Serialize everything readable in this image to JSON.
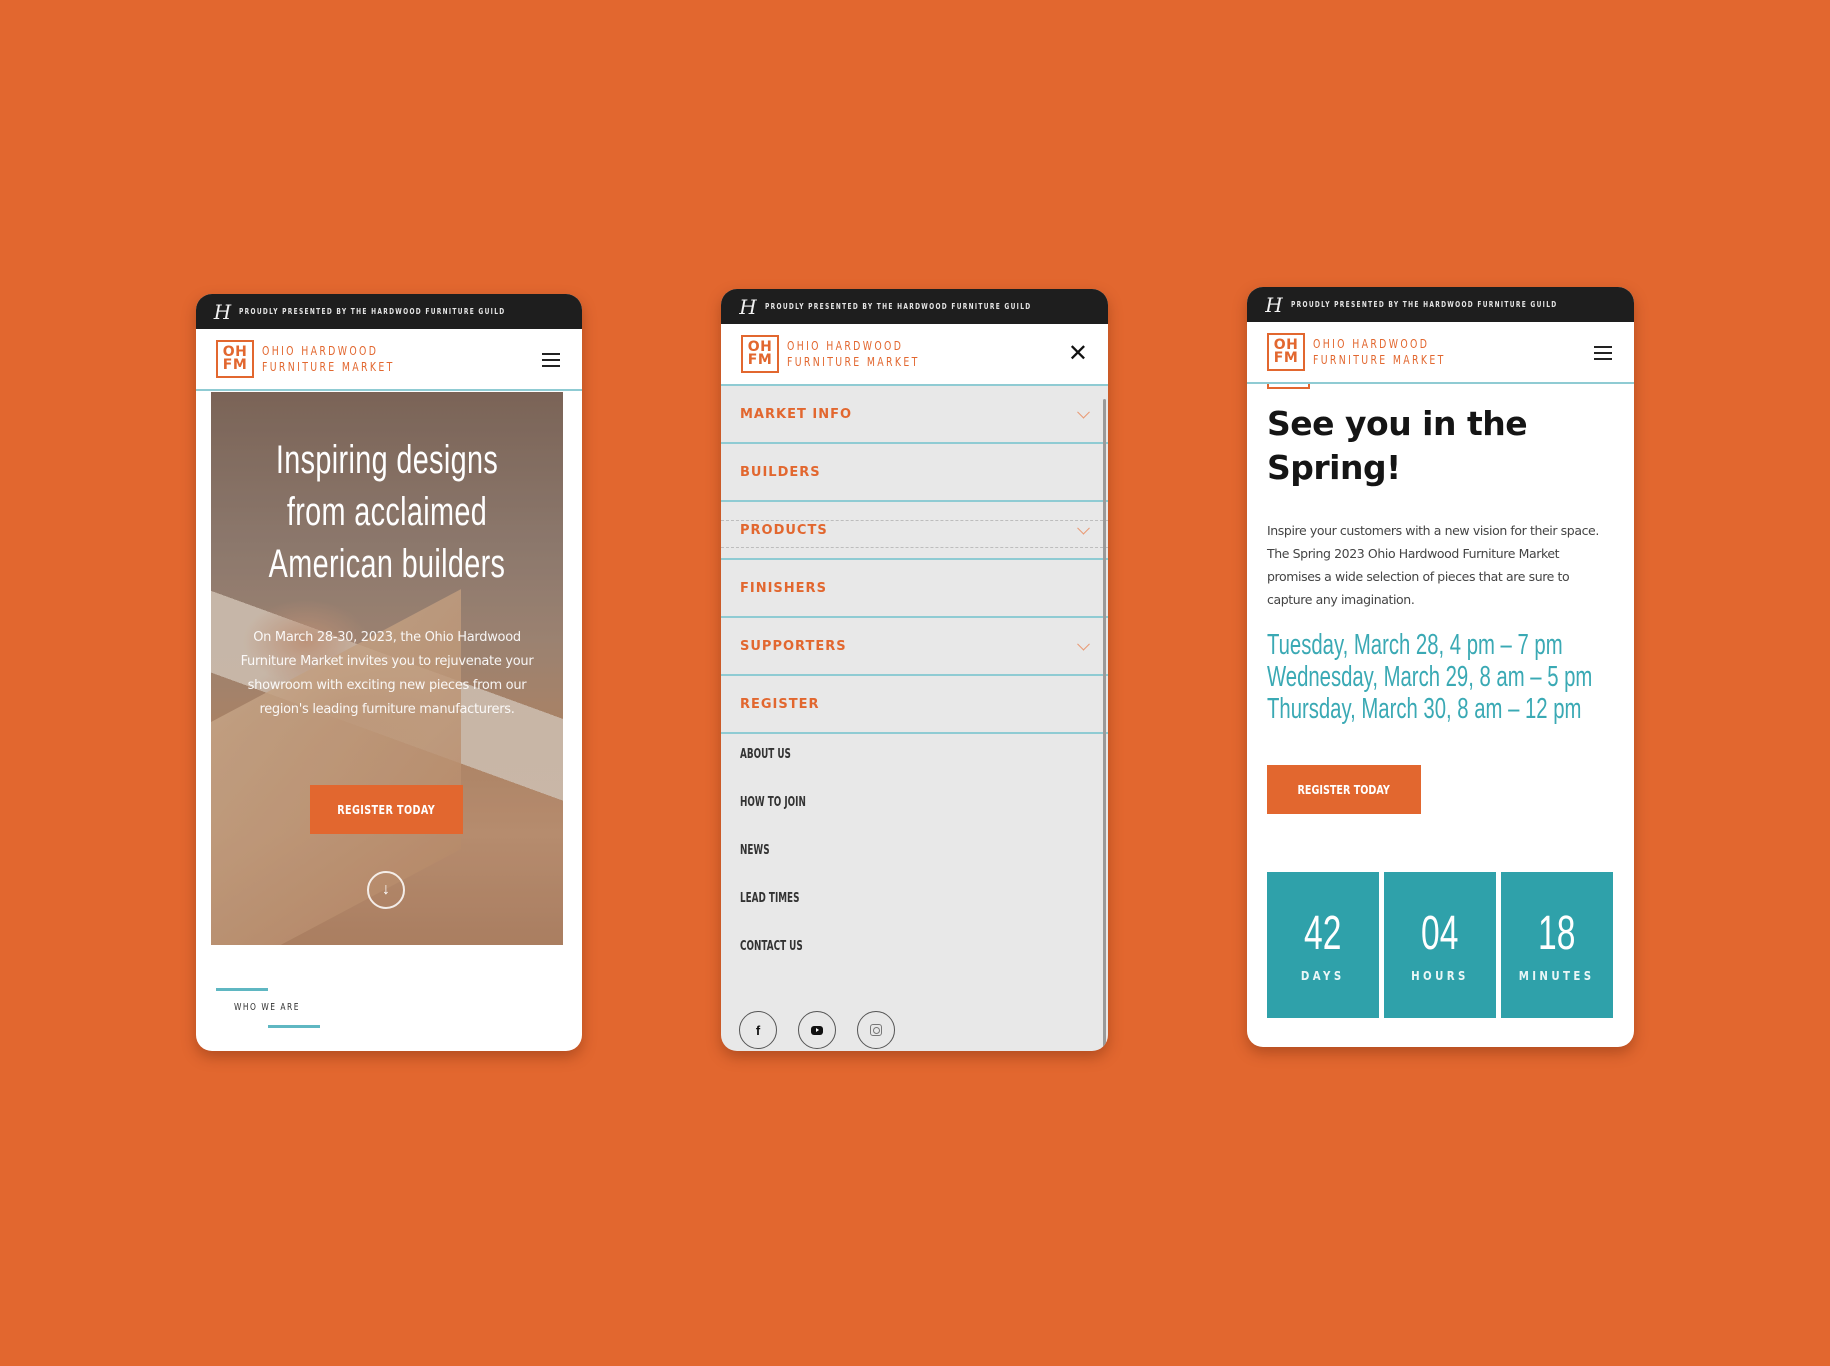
{
  "brand": {
    "tagline": "PROUDLY PRESENTED BY THE HARDWOOD FURNITURE GUILD",
    "guild_mark": "H",
    "logo_mark_top": "OH",
    "logo_mark_bottom": "FM",
    "name_line1": "OHIO HARDWOOD",
    "name_line2": "FURNITURE MARKET",
    "accent_color": "#e2672f",
    "teal_color": "#2fa1aa"
  },
  "home": {
    "hero_title": "Inspiring designs from acclaimed American builders",
    "hero_text": "On March 28-30, 2023, the Ohio Hardwood Furniture Market invites you to rejuvenate your showroom with exciting new pieces from our region's leading furniture manufacturers.",
    "register_label": "REGISTER TODAY",
    "scroll_icon": "arrow-down-circle",
    "section_label": "WHO WE ARE"
  },
  "menu": {
    "primary": [
      {
        "label": "MARKET INFO",
        "has_submenu": true
      },
      {
        "label": "BUILDERS",
        "has_submenu": false
      },
      {
        "label": "PRODUCTS",
        "has_submenu": true
      },
      {
        "label": "FINISHERS",
        "has_submenu": false
      },
      {
        "label": "SUPPORTERS",
        "has_submenu": true
      },
      {
        "label": "REGISTER",
        "has_submenu": false
      }
    ],
    "secondary": [
      "ABOUT US",
      "HOW TO JOIN",
      "NEWS",
      "LEAD TIMES",
      "CONTACT US"
    ],
    "social": [
      "facebook",
      "youtube",
      "instagram"
    ],
    "facebook_glyph": "f"
  },
  "event": {
    "title": "See you in the Spring!",
    "text": "Inspire your customers with a new vision for their space. The Spring 2023 Ohio Hardwood Furniture Market promises a wide selection of pieces that are sure to capture any imagination.",
    "dates": [
      "Tuesday, March 28,  4 pm – 7 pm",
      "Wednesday, March 29, 8 am – 5 pm",
      "Thursday, March 30, 8 am – 12 pm"
    ],
    "register_label": "REGISTER TODAY",
    "countdown": [
      {
        "value": "42",
        "unit": "DAYS"
      },
      {
        "value": "04",
        "unit": "HOURS"
      },
      {
        "value": "18",
        "unit": "MINUTES"
      }
    ]
  }
}
